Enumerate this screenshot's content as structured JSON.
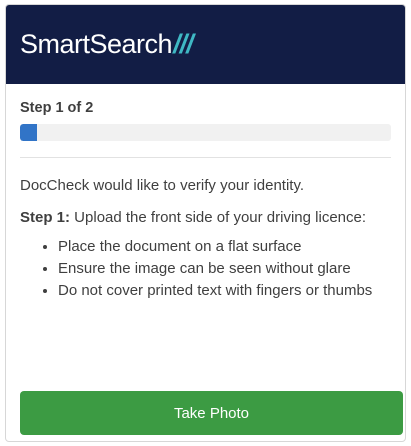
{
  "header": {
    "logo_text": "SmartSearch",
    "logo_slashes": "///",
    "background_color": "#121d45",
    "slash_color": "#3fb8c4"
  },
  "progress": {
    "label": "Step 1 of 2",
    "current_step": 1,
    "total_steps": 2,
    "fill_fraction": 0.045,
    "fill_color": "#3174c7"
  },
  "content": {
    "intro": "DocCheck would like to verify your identity.",
    "step_label": "Step 1:",
    "step_text": " Upload the front side of your driving licence:",
    "bullets": [
      "Place the document on a flat surface",
      "Ensure the image can be seen without glare",
      "Do not cover printed text with fingers or thumbs"
    ]
  },
  "actions": {
    "take_photo_label": "Take Photo",
    "button_color": "#3c9b43"
  }
}
